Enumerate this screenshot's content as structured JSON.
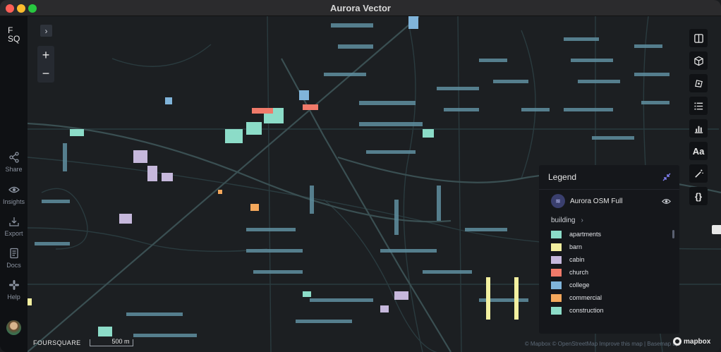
{
  "window": {
    "title": "Aurora Vector"
  },
  "sidebar": {
    "logo_line1": "F",
    "logo_line2": "SQ",
    "items": [
      {
        "label": "Share",
        "icon": "share-icon"
      },
      {
        "label": "Insights",
        "icon": "eye-icon"
      },
      {
        "label": "Export",
        "icon": "export-icon"
      },
      {
        "label": "Docs",
        "icon": "docs-icon"
      },
      {
        "label": "Help",
        "icon": "slack-icon"
      }
    ]
  },
  "map_controls": {
    "zoom_in": "+",
    "zoom_out": "−",
    "expand": "›"
  },
  "right_toolbar": [
    {
      "icon": "split-map-icon"
    },
    {
      "icon": "3d-cube-icon"
    },
    {
      "icon": "draw-polygon-icon"
    },
    {
      "icon": "layer-list-icon"
    },
    {
      "icon": "bar-chart-icon"
    },
    {
      "icon": "text-labels-icon",
      "label": "Aa"
    },
    {
      "icon": "magic-wand-icon"
    },
    {
      "icon": "code-braces-icon",
      "label": "{}"
    }
  ],
  "legend": {
    "title": "Legend",
    "layer": "Aurora OSM Full",
    "field": "building",
    "items": [
      {
        "label": "apartments",
        "color": "#8cdcc8"
      },
      {
        "label": "barn",
        "color": "#f3f0a0"
      },
      {
        "label": "cabin",
        "color": "#c6b8dc"
      },
      {
        "label": "church",
        "color": "#f07a6a"
      },
      {
        "label": "college",
        "color": "#80b4da"
      },
      {
        "label": "commercial",
        "color": "#f4a85c"
      },
      {
        "label": "construction",
        "color": "#8cdcc8"
      }
    ]
  },
  "footer": {
    "brand": "FOURSQUARE",
    "scale": "500 m",
    "attribution": "© Mapbox  © OpenStreetMap  Improve this map | Basemap by:",
    "basemap": "mapbox"
  },
  "colors": {
    "road": "#2a3b3f",
    "major_road": "#3a4f52",
    "house": "#5f8fa0",
    "accent": "#8cdcc8"
  }
}
